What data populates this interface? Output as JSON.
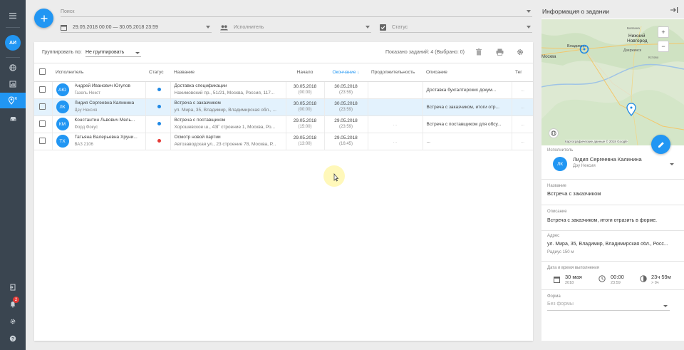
{
  "rail": {
    "user_initials": "АИ",
    "notifications_count": "2"
  },
  "filters": {
    "search_placeholder": "Поиск",
    "date_range": "29.05.2018 00:00 — 30.05.2018 23:59",
    "executor_placeholder": "Исполнитель",
    "status_placeholder": "Статус"
  },
  "toolbar": {
    "group_label": "Группировать по:",
    "group_value": "Не группировать",
    "count_text": "Показано заданий: 4 (Выбрано: 0)"
  },
  "table": {
    "headers": [
      "Исполнитель",
      "Статус",
      "Название",
      "Начало",
      "Окончание",
      "Продолжительность",
      "Описание",
      "Тег"
    ],
    "rows": [
      {
        "initials": "АЮ",
        "name": "Андрей Иванович Югулов",
        "sub": "Газель Некст",
        "status_color": "#1e88e5",
        "title": "Доставка спецификации",
        "address": "Нахимовский пр., 51/21, Москва, Россия, 117...",
        "start_date": "30.05.2018",
        "start_time": "(00:00)",
        "end_date": "30.05.2018",
        "end_time": "(23:59)",
        "duration": "",
        "desc": "Доставка бухгалтерских докум...",
        "tag": "...",
        "selected": false
      },
      {
        "initials": "ЛК",
        "name": "Лидия Сергеевна Калинина",
        "sub": "Дэу Нексия",
        "status_color": "#1e88e5",
        "title": "Встреча с заказчиком",
        "address": "ул. Мира, 35, Владимир, Владимирская обл., ...",
        "start_date": "30.05.2018",
        "start_time": "(00:00)",
        "end_date": "30.05.2018",
        "end_time": "(23:59)",
        "duration": "",
        "desc": "Встреча с заказчиком, итоги отр...",
        "tag": "...",
        "selected": true
      },
      {
        "initials": "КМ",
        "name": "Константин Львович Мель...",
        "sub": "Форд Фокус",
        "status_color": "#1e88e5",
        "title": "Встреча с поставщиком",
        "address": "Хорошевское ш., 43Г строение 1, Москва, Ро...",
        "start_date": "29.05.2018",
        "start_time": "(15:00)",
        "end_date": "29.05.2018",
        "end_time": "(23:59)",
        "duration": "...",
        "desc": "Встреча с поставщиком для обсу...",
        "tag": "...",
        "selected": false
      },
      {
        "initials": "ТХ",
        "name": "Татьяна Валерьевна Хруни...",
        "sub": "ВАЗ 2106",
        "status_color": "#e53935",
        "title": "Осмотр новой партии",
        "address": "Автозаводская ул., 23 строение 78, Москва, Р...",
        "start_date": "29.05.2018",
        "start_time": "(13:00)",
        "end_date": "29.05.2018",
        "end_time": "(16:45)",
        "duration": "...",
        "desc": "...",
        "tag": "...",
        "selected": false
      }
    ]
  },
  "details": {
    "title": "Информация о задании",
    "map": {
      "cities": [
        "Нижний",
        "Новгород",
        "Дзержинск",
        "Владимир",
        "Москва",
        "Балахна",
        "Кстово"
      ],
      "copyright": "Картографические данные © 2018 Google"
    },
    "executor_label": "Исполнитель",
    "executor_initials": "ЛК",
    "executor_name": "Лидия Сергеевна Калинина",
    "executor_car": "Дэу Нексия",
    "name_label": "Название",
    "name_value": "Встреча с заказчиком",
    "desc_label": "Описание",
    "desc_value": "Встреча с заказчиком, итоги отразить в форме.",
    "address_label": "Адрес",
    "address_value": "ул. Мира, 35, Владимир, Владимирская обл., Росс...",
    "radius": "Радиус 150 м",
    "datetime_label": "Дата и время выполнения",
    "date_value": "30 мая",
    "date_year": "2018",
    "time_value": "00:00",
    "time_sub": "23:59",
    "duration_value": "23ч 59м",
    "duration_sub": "> 0ч",
    "form_label": "Форма",
    "form_placeholder": "Без формы"
  }
}
